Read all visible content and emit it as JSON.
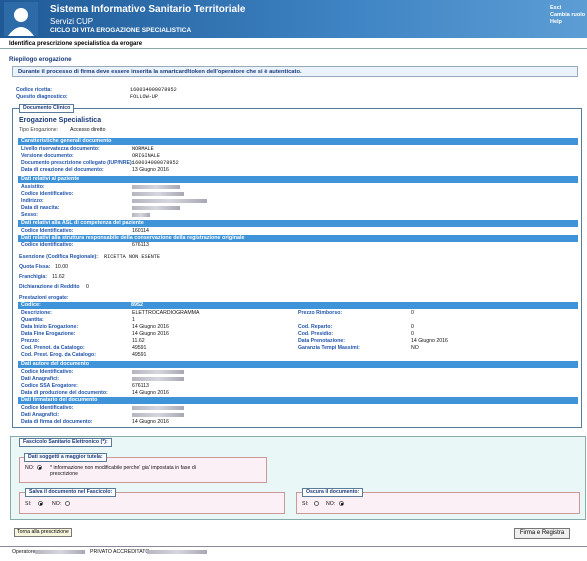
{
  "header": {
    "title": "Sistema Informativo Sanitario Territoriale",
    "subtitle": "Servizi CUP",
    "section": "CICLO DI VITA EROGAZIONE SPECIALISTICA",
    "links": [
      "Esci",
      "Cambia ruolo",
      "Help"
    ]
  },
  "page_title": "Identifica prescrizione specialistica da erogare",
  "riepilogo": {
    "title": "Riepilogo erogazione",
    "notice": "Durante il processo di firma deve essere inserita la smartcard\\token dell'operatore che si è autenticato.",
    "codice_ricetta_label": "Codice ricetta:",
    "codice_ricetta": "160034000078952",
    "quesito_label": "Quesito diagnostico:",
    "quesito": "FOLLOW-UP"
  },
  "doc": {
    "legend": "Documento Clinico",
    "title": "Erogazione Specialistica",
    "tipo_label": "Tipo Erogazione:",
    "tipo": "Accesso diretto"
  },
  "caratteristiche": {
    "title": "Caratteristiche generali documento",
    "rows": [
      {
        "label": "Livello riservatezza documento:",
        "value": "NORMALE"
      },
      {
        "label": "Versione documento:",
        "value": "ORIGINALE"
      },
      {
        "label": "Documento prescrizione collegato (IUP/NRE):",
        "value": "160034000078952"
      },
      {
        "label": "Data di creazione del documento:",
        "value": "13 Giugno 2016"
      }
    ]
  },
  "paziente": {
    "title": "Dati relativi al paziente",
    "rows": [
      "Assistito:",
      "Codice identificativo:",
      "Indirizzo:",
      "Data di nascita:",
      "Sesso:"
    ]
  },
  "asl": {
    "title": "Dati relativi alla ASL di competenza del paziente",
    "label": "Codice Identificativo:",
    "value": "160114"
  },
  "struttura": {
    "title": "Dati relativi alla struttura responsabile della conservazione della registrazione originale",
    "label": "Codice identificativo:",
    "value": "676113"
  },
  "esenzione": {
    "label": "Esenzione (Codifica Regionale):",
    "value": "RICETTA NON ESENTE"
  },
  "quota": {
    "label": "Quota Fissa:",
    "value": "10.00"
  },
  "franchigia": {
    "label": "Franchigia:",
    "value": "11.62"
  },
  "reddito": {
    "label": "Dichiarazione di Reddito",
    "value": "0"
  },
  "prestazioni": {
    "label": "Prestazioni erogate:",
    "codice_label": "Codice:",
    "codice": "8952",
    "left": [
      {
        "label": "Descrizione:",
        "value": "ELETTROCARDIOGRAMMA"
      },
      {
        "label": "Quantita:",
        "value": "1"
      },
      {
        "label": "Data Inizio Erogazione:",
        "value": "14 Giugno 2016"
      },
      {
        "label": "Data Fine Erogazione:",
        "value": "14 Giugno 2016"
      },
      {
        "label": "Prezzo:",
        "value": "11.62"
      },
      {
        "label": "Cod. Prenot. da Catalogo:",
        "value": "49591"
      },
      {
        "label": "Cod. Prest. Erog. da Catalogo:",
        "value": "49591"
      }
    ],
    "right": [
      {
        "label": "Prezzo Rimborso:",
        "value": "0"
      },
      {
        "label": "",
        "value": ""
      },
      {
        "label": "Cod. Reparto:",
        "value": "0"
      },
      {
        "label": "Cod. Presidio:",
        "value": "0"
      },
      {
        "label": "Data Prenotazione:",
        "value": "14 Giugno 2016"
      },
      {
        "label": "Garanzia Tempi Massimi:",
        "value": "NO"
      },
      {
        "label": "",
        "value": ""
      }
    ]
  },
  "autore": {
    "title": "Dati autore del documento",
    "rows": [
      {
        "label": "Codice Identificativo:",
        "value": ""
      },
      {
        "label": "Dati Anagrafici:",
        "value": ""
      },
      {
        "label": "Codice SSA Erogatore:",
        "value": "676113"
      },
      {
        "label": "Data di produzione del documento:",
        "value": "14 Giugno 2016"
      }
    ]
  },
  "firmatario": {
    "title": "Dati firmatario del documento",
    "rows": [
      {
        "label": "Codice Identificativo:",
        "value": ""
      },
      {
        "label": "Dati Anagrafici:",
        "value": ""
      },
      {
        "label": "Data di firma del documento:",
        "value": "14 Giugno 2016"
      }
    ]
  },
  "fse": {
    "legend": "Fascicolo Sanitario Elettronico (*):",
    "tutela_legend": "Dati soggetti a maggior tutela:",
    "tutela_no": "NO:",
    "tutela_text": "* informazione non modificabile perche' gia' impostata in fase di prescrizione",
    "salva_legend": "Salva il documento nel Fascicolo:",
    "oscura_legend": "Oscura il documento:",
    "si": "SI:",
    "no": "NO:"
  },
  "buttons": {
    "back": "Torna alla prescrizione",
    "sign": "Firma e Registra"
  },
  "footer": {
    "operatore": "Operatore",
    "privato": "PRIVATO ACCREDITATO -"
  }
}
